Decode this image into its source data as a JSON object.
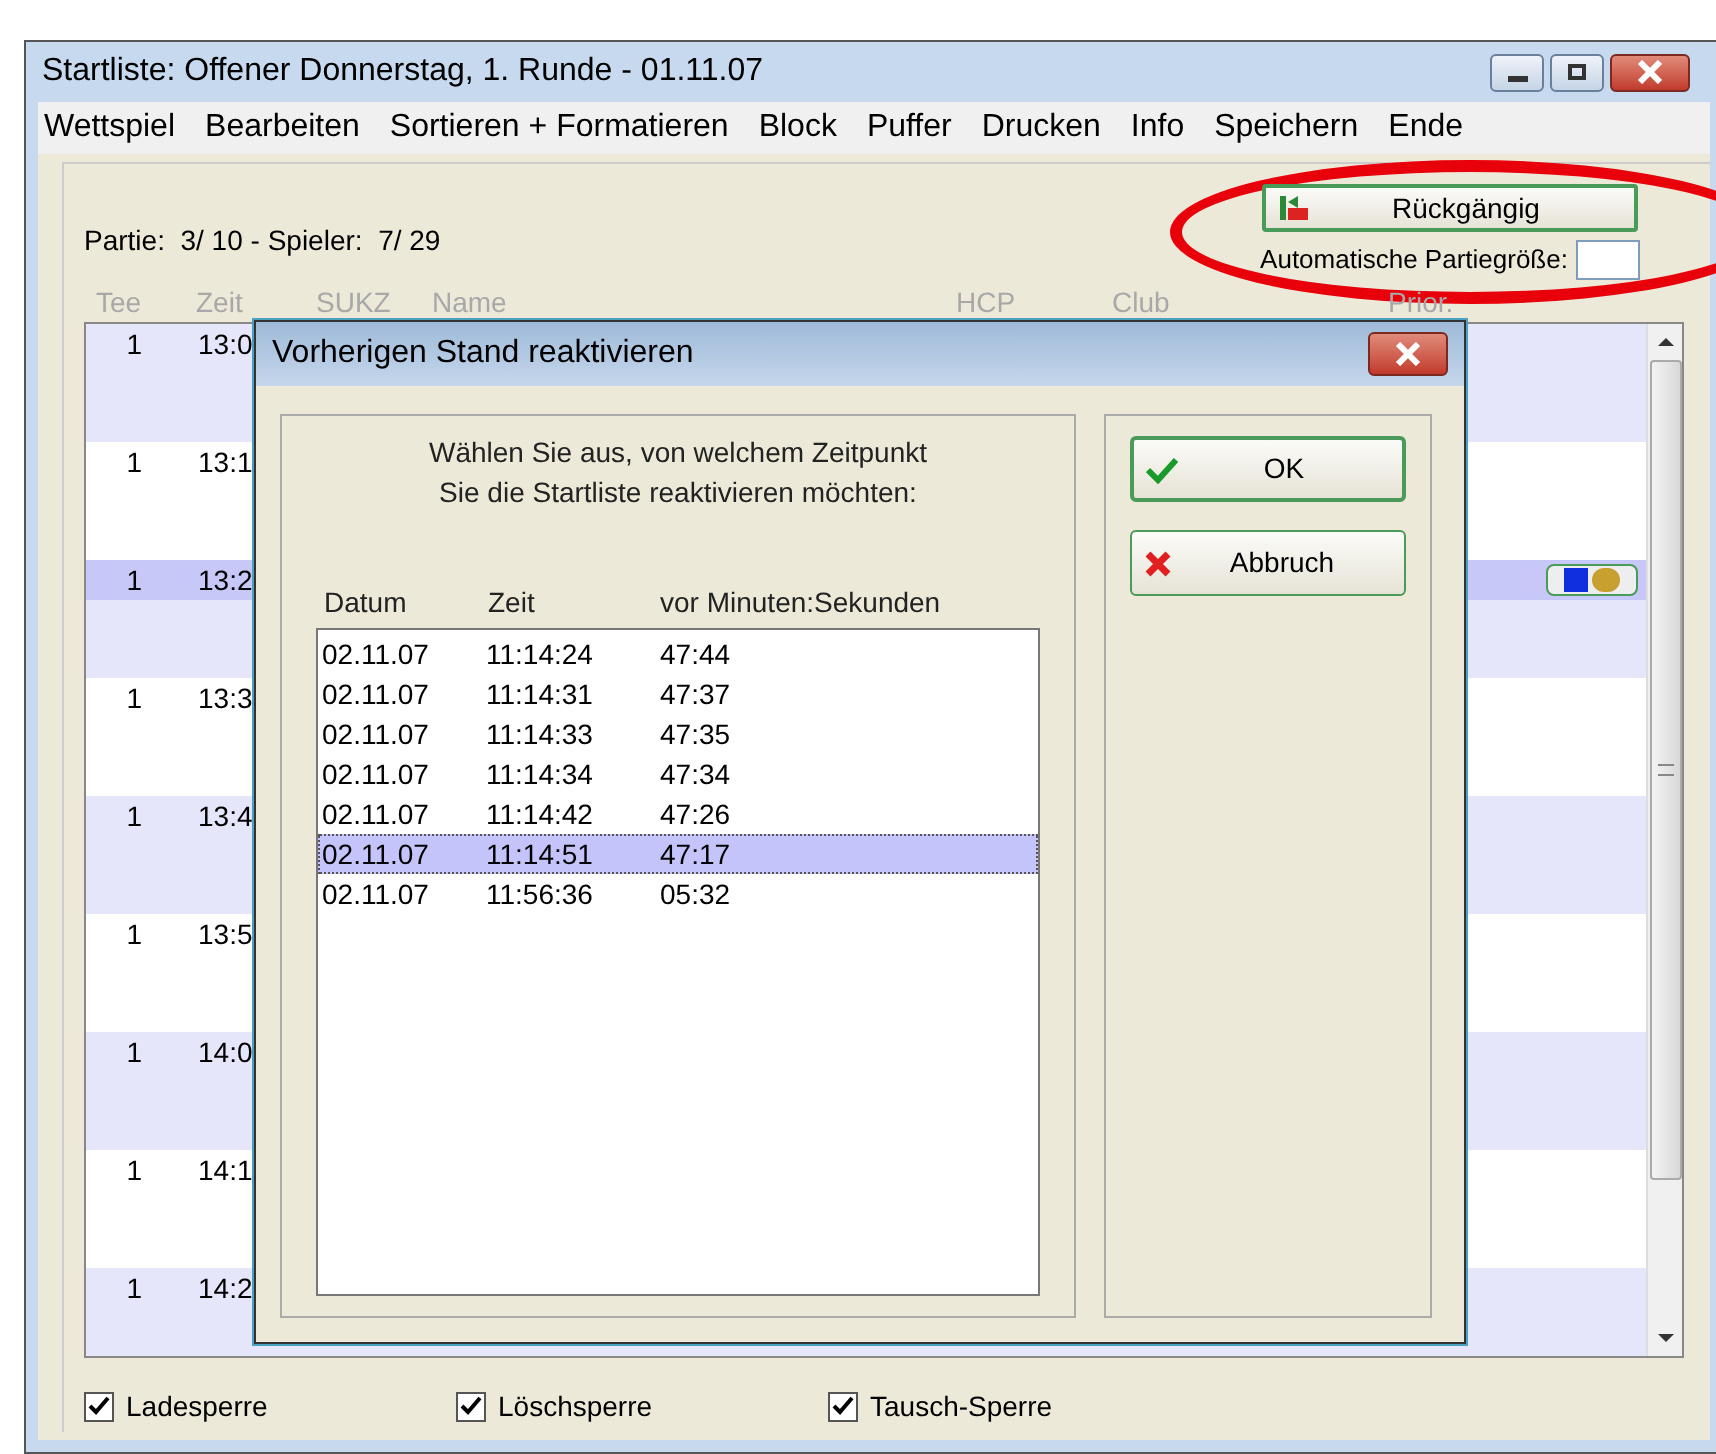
{
  "window": {
    "title": "Startliste: Offener Donnerstag, 1. Runde - 01.11.07"
  },
  "menu": [
    "Wettspiel",
    "Bearbeiten",
    "Sortieren + Formatieren",
    "Block",
    "Puffer",
    "Drucken",
    "Info",
    "Speichern",
    "Ende"
  ],
  "undo_button": {
    "label": "Rückgängig"
  },
  "info_line": "Partie:  3/ 10 - Spieler:  7/ 29",
  "auto_size": {
    "label": "Automatische Partiegröße:"
  },
  "columns": [
    "Tee",
    "Zeit",
    "SUKZ",
    "Name",
    "HCP",
    "Club",
    "Prior."
  ],
  "groups": [
    {
      "tee": "1",
      "time": "13:0",
      "selected": false,
      "info": false
    },
    {
      "tee": "1",
      "time": "13:1",
      "selected": false,
      "info": false
    },
    {
      "tee": "1",
      "time": "13:2",
      "selected": true,
      "info": true
    },
    {
      "tee": "1",
      "time": "13:3",
      "selected": false,
      "info": false
    },
    {
      "tee": "1",
      "time": "13:4",
      "selected": false,
      "info": false
    },
    {
      "tee": "1",
      "time": "13:5",
      "selected": false,
      "info": false
    },
    {
      "tee": "1",
      "time": "14:0",
      "selected": false,
      "info": false
    },
    {
      "tee": "1",
      "time": "14:1",
      "selected": false,
      "info": false
    },
    {
      "tee": "1",
      "time": "14:2",
      "selected": false,
      "info": false
    }
  ],
  "locks": [
    {
      "label": "Ladesperre",
      "checked": true
    },
    {
      "label": "Löschsperre",
      "checked": true
    },
    {
      "label": "Tausch-Sperre",
      "checked": true
    }
  ],
  "dialog": {
    "title": "Vorherigen Stand reaktivieren",
    "prompt": "Wählen Sie aus, von welchem Zeitpunkt\nSie die Startliste reaktivieren möchten:",
    "columns": [
      "Datum",
      "Zeit",
      "vor Minuten:Sekunden"
    ],
    "rows": [
      {
        "date": "02.11.07",
        "time": "11:14:24",
        "ago": "47:44",
        "selected": false
      },
      {
        "date": "02.11.07",
        "time": "11:14:31",
        "ago": "47:37",
        "selected": false
      },
      {
        "date": "02.11.07",
        "time": "11:14:33",
        "ago": "47:35",
        "selected": false
      },
      {
        "date": "02.11.07",
        "time": "11:14:34",
        "ago": "47:34",
        "selected": false
      },
      {
        "date": "02.11.07",
        "time": "11:14:42",
        "ago": "47:26",
        "selected": false
      },
      {
        "date": "02.11.07",
        "time": "11:14:51",
        "ago": "47:17",
        "selected": true
      },
      {
        "date": "02.11.07",
        "time": "11:56:36",
        "ago": "05:32",
        "selected": false
      }
    ],
    "buttons": [
      {
        "label": "OK",
        "kind": "ok"
      },
      {
        "label": "Abbruch",
        "kind": "cancel"
      }
    ]
  }
}
